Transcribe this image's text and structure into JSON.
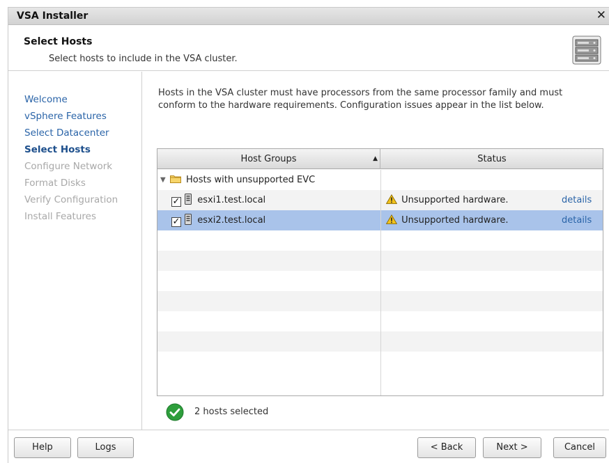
{
  "window": {
    "title": "VSA Installer",
    "close_glyph": "✕"
  },
  "header": {
    "title": "Select Hosts",
    "subtitle": "Select hosts to include in the VSA cluster.",
    "icon": "server-rack-icon"
  },
  "sidebar": {
    "items": [
      {
        "label": "Welcome",
        "state": "link"
      },
      {
        "label": "vSphere Features",
        "state": "link"
      },
      {
        "label": "Select Datacenter",
        "state": "link"
      },
      {
        "label": "Select Hosts",
        "state": "current"
      },
      {
        "label": "Configure Network",
        "state": "disabled"
      },
      {
        "label": "Format Disks",
        "state": "disabled"
      },
      {
        "label": "Verify Configuration",
        "state": "disabled"
      },
      {
        "label": "Install Features",
        "state": "disabled"
      }
    ]
  },
  "main": {
    "description": "Hosts in the VSA cluster must have processors from the same processor family and must conform to the hardware requirements. Configuration issues appear in the list below.",
    "table": {
      "columns": [
        "Host Groups",
        "Status"
      ],
      "sort_indicator": "▲",
      "group": {
        "label": "Hosts with unsupported EVC",
        "expanded_glyph": "▼"
      },
      "hosts": [
        {
          "name": "esxi1.test.local",
          "checked": true,
          "status": "Unsupported hardware.",
          "details": "details",
          "selected": false
        },
        {
          "name": "esxi2.test.local",
          "checked": true,
          "status": "Unsupported hardware.",
          "details": "details",
          "selected": true
        }
      ]
    },
    "summary": "2 hosts selected"
  },
  "footer": {
    "help": "Help",
    "logs": "Logs",
    "back": "< Back",
    "next": "Next >",
    "cancel": "Cancel"
  },
  "colors": {
    "link": "#2a64a8",
    "selected_row": "#a9c3ea",
    "disabled": "#a8a8a8",
    "success": "#2e9e3c",
    "warning": "#f2c21b"
  }
}
